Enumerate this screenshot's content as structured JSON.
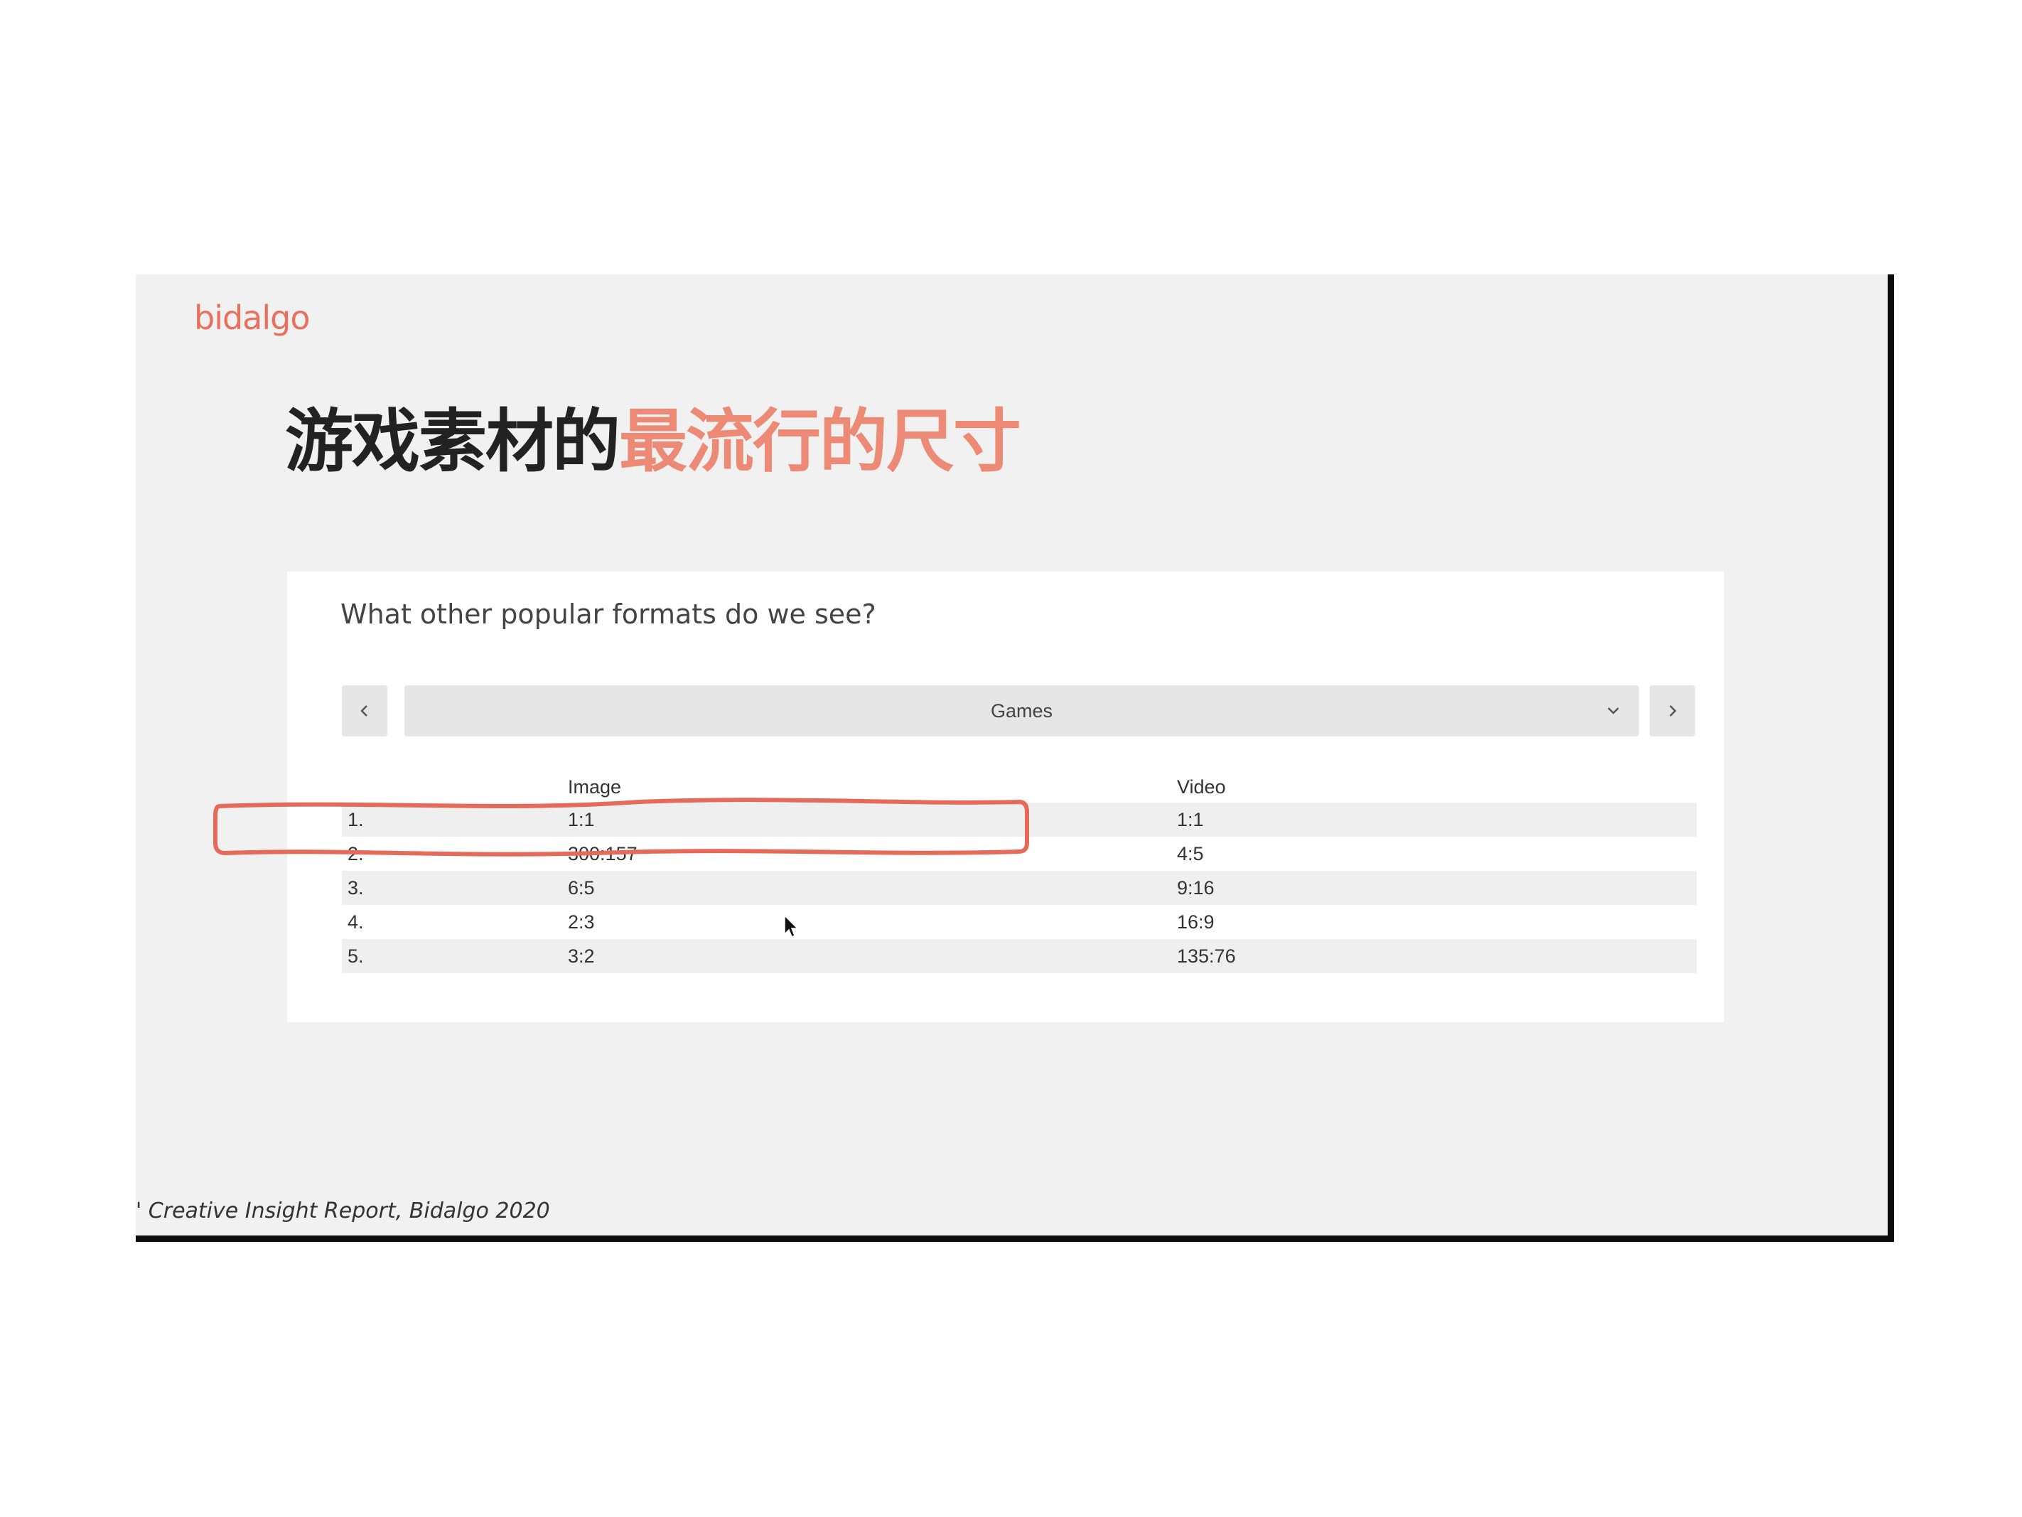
{
  "slide": {
    "logo": "bidalgo",
    "title_dark": "游戏素材的",
    "title_accent": "最流行的尺寸",
    "footer": "' Creative Insight Report, Bidalgo 2020"
  },
  "card": {
    "question": "What other popular formats do we see?",
    "category_select": {
      "value": "Games"
    },
    "table": {
      "columns": [
        "",
        "Image",
        "Video"
      ],
      "rows": [
        {
          "rank": "1.",
          "image": "1:1",
          "video": "1:1"
        },
        {
          "rank": "2.",
          "image": "300:157",
          "video": "4:5"
        },
        {
          "rank": "3.",
          "image": "6:5",
          "video": "9:16"
        },
        {
          "rank": "4.",
          "image": "2:3",
          "video": "16:9"
        },
        {
          "rank": "5.",
          "image": "3:2",
          "video": "135:76"
        }
      ]
    }
  },
  "colors": {
    "accent": "#ec8a76",
    "logo": "#e8705c",
    "highlight_stroke": "#e56a5a",
    "slide_background": "#f1f1f1"
  },
  "icons": {
    "prev": "chevron-left-icon",
    "next": "chevron-right-icon",
    "dropdown": "chevron-down-icon",
    "pointer": "mouse-cursor-icon"
  }
}
